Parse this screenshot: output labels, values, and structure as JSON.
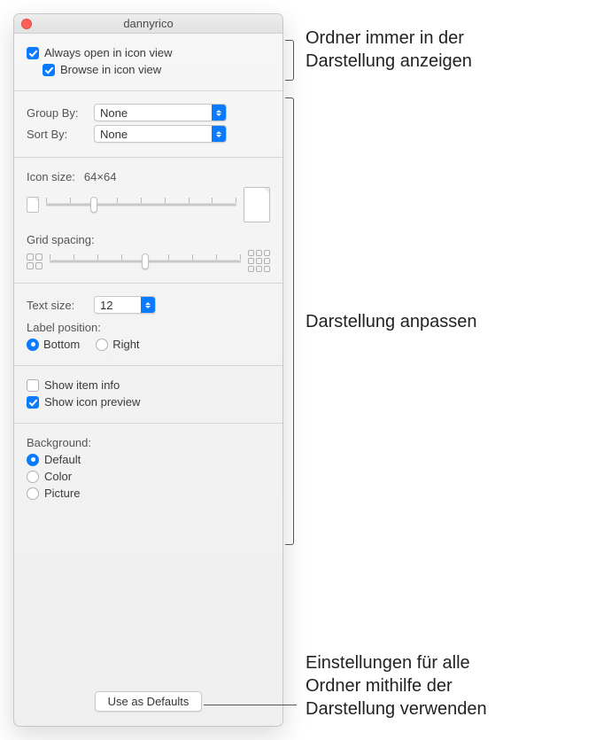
{
  "window": {
    "title": "dannyrico"
  },
  "iconView": {
    "alwaysOpenLabel": "Always open in icon view",
    "alwaysOpenChecked": true,
    "browseLabel": "Browse in icon view",
    "browseChecked": true
  },
  "groupSort": {
    "groupByLabel": "Group By:",
    "groupByValue": "None",
    "sortByLabel": "Sort By:",
    "sortByValue": "None"
  },
  "iconSize": {
    "label": "Icon size:",
    "valueText": "64×64",
    "sliderPercent": 25
  },
  "gridSpacing": {
    "label": "Grid spacing:",
    "sliderPercent": 50
  },
  "textSize": {
    "label": "Text size:",
    "value": "12"
  },
  "labelPosition": {
    "label": "Label position:",
    "bottomLabel": "Bottom",
    "rightLabel": "Right",
    "selected": "Bottom"
  },
  "showOptions": {
    "itemInfoLabel": "Show item info",
    "itemInfoChecked": false,
    "iconPreviewLabel": "Show icon preview",
    "iconPreviewChecked": true
  },
  "background": {
    "label": "Background:",
    "options": {
      "default": "Default",
      "color": "Color",
      "picture": "Picture"
    },
    "selected": "Default"
  },
  "defaultsButton": "Use as Defaults",
  "annotations": {
    "top": "Ordner immer in der\nDarstellung anzeigen",
    "middle": "Darstellung anpassen",
    "bottom": "Einstellungen für alle\nOrdner mithilfe der\nDarstellung verwenden"
  }
}
